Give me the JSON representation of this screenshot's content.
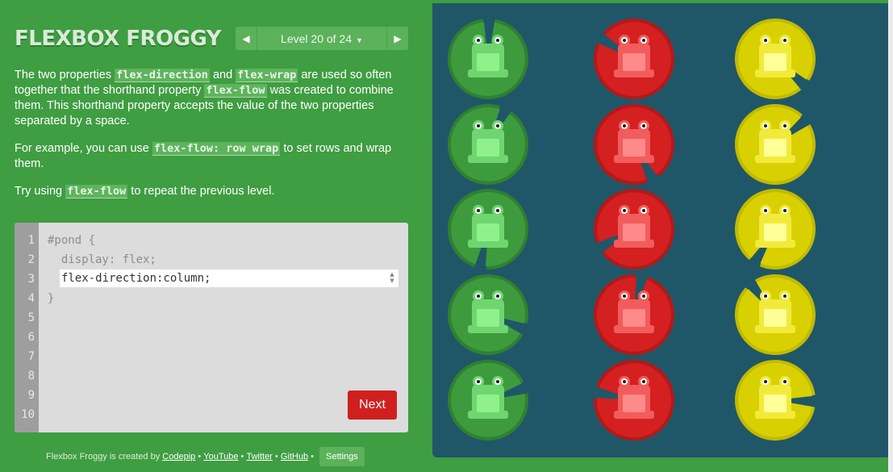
{
  "header": {
    "title": "FLEXBOX FROGGY",
    "level_label": "Level 20 of 24",
    "prev_icon": "triangle-left-icon",
    "next_icon": "triangle-right-icon",
    "dropdown_icon": "caret-down-icon"
  },
  "instructions": {
    "p1": {
      "t1": "The two properties ",
      "c1": "flex-direction",
      "t2": " and ",
      "c2": "flex-wrap",
      "t3": " are used so often together that the shorthand property ",
      "c3": "flex-flow",
      "t4": " was created to combine them. This shorthand property accepts the value of the two properties separated by a space."
    },
    "p2": {
      "t1": "For example, you can use ",
      "c1": "flex-flow: row wrap",
      "t2": " to set rows and wrap them."
    },
    "p3": {
      "t1": "Try using ",
      "c1": "flex-flow",
      "t2": " to repeat the previous level."
    }
  },
  "editor": {
    "line_numbers": [
      "1",
      "2",
      "3",
      "4",
      "5",
      "6",
      "7",
      "8",
      "9",
      "10"
    ],
    "line1": "#pond {",
    "line2": "  display: flex;",
    "input_value": "flex-direction:column;",
    "line4": "}",
    "next_label": "Next"
  },
  "footer": {
    "prefix": "Flexbox Froggy is created by ",
    "links": [
      "Codepip",
      "YouTube",
      "Twitter",
      "GitHub"
    ],
    "separator": " • ",
    "settings_label": "Settings"
  },
  "pond": {
    "columns": [
      {
        "color": "green",
        "frogs": 5
      },
      {
        "color": "red",
        "frogs": 5
      },
      {
        "color": "yellow",
        "frogs": 5
      }
    ]
  },
  "colors": {
    "background": "#3f9d42",
    "pond": "#1f5768",
    "green_pad": "#3d9b3e",
    "green_pad_dark": "#2f8130",
    "green_frog": "#6fd66f",
    "green_frog_belly": "#8ff08c",
    "red_pad": "#d42020",
    "red_pad_dark": "#b51818",
    "red_frog": "#f25c5c",
    "red_frog_belly": "#ff8a8a",
    "yellow_pad": "#d8d000",
    "yellow_pad_dark": "#c2ba00",
    "yellow_frog": "#f2ea3a",
    "yellow_frog_belly": "#ffff99",
    "next_button": "#d01f1f"
  }
}
